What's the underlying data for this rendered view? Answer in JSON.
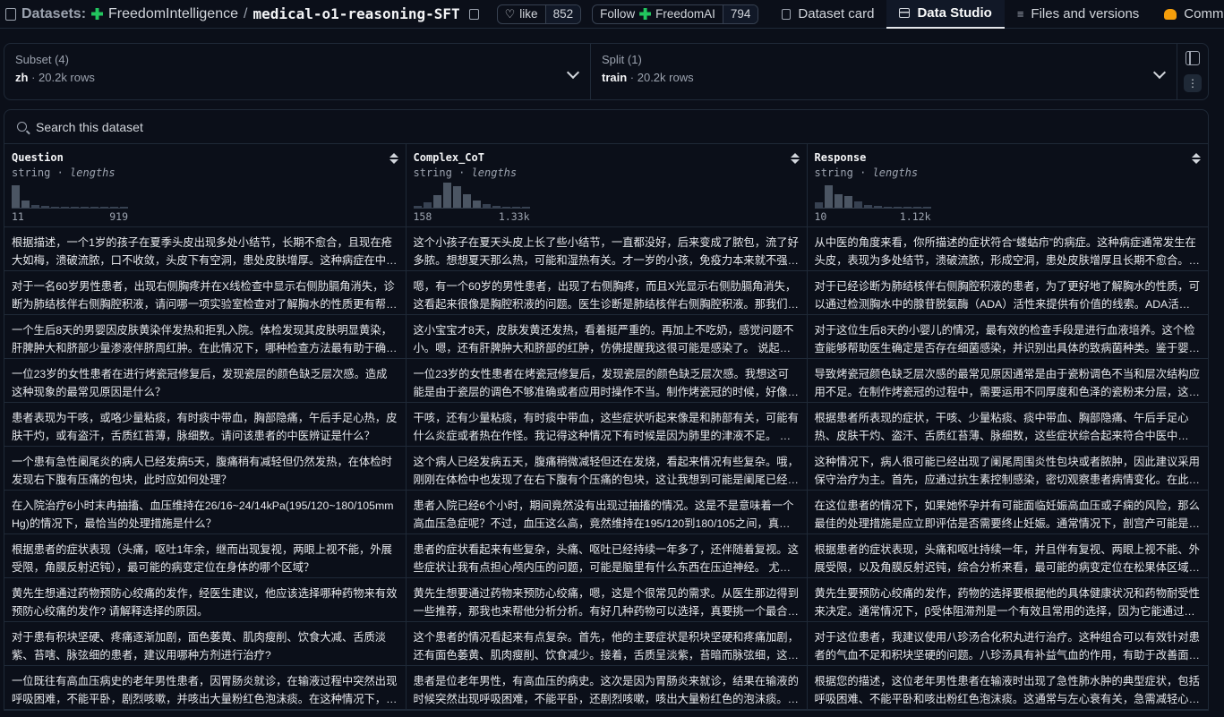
{
  "header": {
    "crumb_label": "Datasets:",
    "org": "FreedomIntelligence",
    "separator": "/",
    "repo": "medical-o1-reasoning-SFT",
    "like_label": "like",
    "like_count": "852",
    "follow_label": "Follow",
    "follow_org": "FreedomAI",
    "follow_count": "794",
    "tabs": [
      {
        "label": "Dataset card",
        "icon": "dataset-card-icon"
      },
      {
        "label": "Data Studio",
        "icon": "table-icon",
        "active": true
      },
      {
        "label": "Files and versions",
        "icon": "files-icon"
      },
      {
        "label": "Commun",
        "icon": "community-icon"
      }
    ]
  },
  "subset": {
    "label": "Subset (4)",
    "value": "zh",
    "rows": "20.2k rows"
  },
  "split": {
    "label": "Split (1)",
    "value": "train",
    "rows": "20.2k rows"
  },
  "search": {
    "placeholder": "Search this dataset"
  },
  "columns": [
    {
      "name": "Question",
      "type": "string",
      "meta": "lengths",
      "min": "11",
      "max": "919",
      "hist": [
        0.9,
        0.3,
        0.12,
        0.08,
        0.05,
        0.04,
        0.03,
        0.02,
        0.02,
        0.02,
        0.02,
        0.01
      ]
    },
    {
      "name": "Complex_CoT",
      "type": "string",
      "meta": "lengths",
      "min": "158",
      "max": "1.33k",
      "hist": [
        0.08,
        0.2,
        0.5,
        1.0,
        0.85,
        0.55,
        0.3,
        0.15,
        0.08,
        0.04,
        0.02,
        0.01
      ]
    },
    {
      "name": "Response",
      "type": "string",
      "meta": "lengths",
      "min": "10",
      "max": "1.12k",
      "hist": [
        0.2,
        0.9,
        0.55,
        0.45,
        0.25,
        0.12,
        0.06,
        0.04,
        0.02,
        0.01,
        0.01,
        0.01
      ]
    }
  ],
  "rows": [
    [
      "根据描述，一个1岁的孩子在夏季头皮出现多处小结节，长期不愈合，且现在疮大如梅，溃破流脓，口不收敛，头皮下有空洞，患处皮肤增厚。这种病症在中医中是什么？",
      "这个小孩子在夏天头皮上长了些小结节，一直都没好，后来变成了脓包，流了好多脓。想想夏天那么热，可能和湿热有关。才一岁的小孩，免疫力本来就不强，夏天的湿热没准就侵袭了身体。",
      "从中医的角度来看，你所描述的症状符合“蝼蛄疖”的病症。这种病症通常发生在头皮，表现为多处结节，溃破流脓，形成空洞，患处皮肤增厚且长期不愈合。湿热较重的夏季更容易导致这种病症的发展。"
    ],
    [
      "对于一名60岁男性患者，出现右侧胸疼并在X线检查中显示右侧肋膈角消失，诊断为肺结核伴右侧胸腔积液，请问哪一项实验室检查对了解胸水的性质更有帮助？",
      "嗯，有一个60岁的男性患者，出现了右侧胸疼，而且X光显示右侧肋膈角消失，这看起来很像是胸腔积液的问题。医生诊断是肺结核伴右侧胸腔积液。那我们就得想想，应该做什么检查。",
      "对于已经诊断为肺结核伴右侧胸腔积液的患者，为了更好地了解胸水的性质，可以通过检测胸水中的腺苷脱氨酶（ADA）活性来提供有价值的线索。ADA活性高通常提示结核性胸膜炎。"
    ],
    [
      "一个生后8天的男婴因皮肤黄染伴发热和拒乳入院。体检发现其皮肤明显黄染，肝脾肿大和脐部少量渗液伴脐周红肿。在此情况下，哪种检查方法最有助于确诊感染源？",
      "这小宝宝才8天，皮肤发黄还发热，看着挺严重的。再加上不吃奶，感觉问题不小。嗯，还有肝脾肿大和脐部的红肿，仿佛提醒我这很可能是感染了。  说起新生儿感染，常见的有败血症。",
      "对于这位生后8天的小婴儿的情况，最有效的检查手段是进行血液培养。这个检查能够帮助医生确定是否存在细菌感染，并识别出具体的致病菌种类。鉴于婴儿表现出的症状，这一点尤为重要。"
    ],
    [
      "一位23岁的女性患者在进行烤瓷冠修复后，发现瓷层的颜色缺乏层次感。造成这种现象的最常见原因是什么？",
      "一位23岁的女性患者在烤瓷冠修复后，发现瓷层的颜色缺乏层次感。我想这可能是由于瓷层的调色不够准确或者应用时操作不当。制作烤瓷冠的时候，好像需要一层层地叠加瓷粉。",
      "导致烤瓷冠颜色缺乏层次感的最常见原因通常是由于瓷粉调色不当和层次结构应用不足。在制作烤瓷冠的过程中，需要运用不同厚度和色泽的瓷粉来分层，这样才能呈现自然的层次。"
    ],
    [
      "患者表现为干咳，或咯少量粘痰，有时痰中带血，胸部隐痛，午后手足心热，皮肤干灼，或有盗汗，舌质红苔薄，脉细数。请问该患者的中医辨证是什么？",
      "干咳，还有少量粘痰，有时痰中带血，这些症状听起来像是和肺部有关，可能有什么炎症或者热在作怪。我记得这种情况下有时候是因为肺里的津液不足。  接着是午后手足心热。",
      "根据患者所表现的症状，干咳、少量粘痰、痰中带血、胸部隐痛、午后手足心热、皮肤干灼、盗汗、舌质红苔薄、脉细数，这些症状综合起来符合中医中的“肺阴亏耗”证候。"
    ],
    [
      "一个患有急性阑尾炎的病人已经发病5天，腹痛稍有减轻但仍然发热，在体检时发现右下腹有压痛的包块，此时应如何处理？",
      "这个病人已经发病五天，腹痛稍微减轻但还在发烧，看起来情况有些复杂。哦，刚刚在体检中也发现了在右下腹有个压痛的包块，这让我想到可能是阑尾已经形成了脓肿。",
      "这种情况下，病人很可能已经出现了阑尾周围炎性包块或者脓肿，因此建议采用保守治疗为主。首先，应通过抗生素控制感染，密切观察患者病情变化。在此期间，若症状加重应考虑手术。"
    ],
    [
      "在入院治疗6小时末冉抽搐、血压维持在26/16~24/14kPa(195/120~180/105mmHg)的情况下，最恰当的处理措施是什么？",
      "患者入院已经6个小时，期间竟然没有出现过抽搐的情况。这是不是意味着一个高血压急症呢？不过，血压这么高，竟然维持在195/120到180/105之间，真担心会出现什么并发症。",
      "在这位患者的情况下，如果她怀孕并有可能面临妊娠高血压或子痫的风险，那么最佳的处理措施是应立即评估是否需要终止妊娠。通常情况下，剖宫产可能是最妥当的选择。"
    ],
    [
      "根据患者的症状表现（头痛，呕吐1年余，继而出现复视，两眼上视不能，外展受限，角膜反射迟钝），最可能的病变定位在身体的哪个区域？",
      "患者的症状看起来有些复杂，头痛、呕吐已经持续一年多了，还伴随着复视。这些症状让我有点担心颅内压的问题，可能是脑里有什么东西在压迫神经。  尤其是两眼上视不能。",
      "根据患者的症状表现，头痛和呕吐持续一年，并且伴有复视、两眼上视不能、外展受限，以及角膜反射迟钝，综合分析来看，最可能的病变定位在松果体区域。  这一区域的病变常见。"
    ],
    [
      "黄先生想通过药物预防心绞痛的发作，经医生建议，他应该选择哪种药物来有效预防心绞痛的发作? 请解释选择的原因。",
      "黄先生想要通过药物来预防心绞痛，嗯，这是个很常见的需求。从医生那边得到一些推荐，那我也来帮他分析分析。有好几种药物可以选择，真要挑一个最合适的还得看情况。",
      "黄先生要预防心绞痛的发作，药物的选择要根据他的具体健康状况和药物耐受性来决定。通常情况下，β受体阻滞剂是一个有效且常用的选择，因为它能通过减慢心率来降低心肌耗氧。"
    ],
    [
      "对于患有积块坚硬、疼痛逐渐加剧，面色萎黄、肌肉瘦削、饮食大减、舌质淡紫、苔嗐、脉弦细的患者，建议用哪种方剂进行治疗?",
      "这个患者的情况看起来有点复杂。首先，他的主要症状是积块坚硬和疼痛加剧，还有面色萎黄、肌肉瘦削、饮食减少。接着，舌质呈淡紫，苔暗而脉弦细，这些都指向了气血亏虚。",
      "对于这位患者，我建议使用八珍汤合化积丸进行治疗。这种组合可以有效针对患者的气血不足和积块坚硬的问题。八珍汤具有补益气血的作用，有助于改善面色萎黄、肌肉瘦削等症状。"
    ],
    [
      "一位既往有高血压病史的老年男性患者，因胃肠炎就诊，在输液过程中突然出现呼吸困难，不能平卧，剧烈咳嗽，并咳出大量粉红色泡沫痰。在这种情况下，最宜采取的措施是什么？",
      "患者是位老年男性，有高血压的病史。这次是因为胃肠炎来就诊，结果在输液的时候突然出现呼吸困难，不能平卧，还剧烈咳嗽，咳出大量粉红色的泡沫痰。这看起来像是急性肺水肿。",
      "根据您的描述，这位老年男性患者在输液时出现了急性肺水肿的典型症状，包括呼吸困难、不能平卧和咳出粉红色泡沫痰。这通常与左心衰有关，急需减轻心脏的负荷并改善氧合。"
    ]
  ],
  "colors": {
    "bg": "#0b0f19",
    "border": "#1f2937",
    "text": "#e5e7eb",
    "muted": "#9ca3af"
  }
}
